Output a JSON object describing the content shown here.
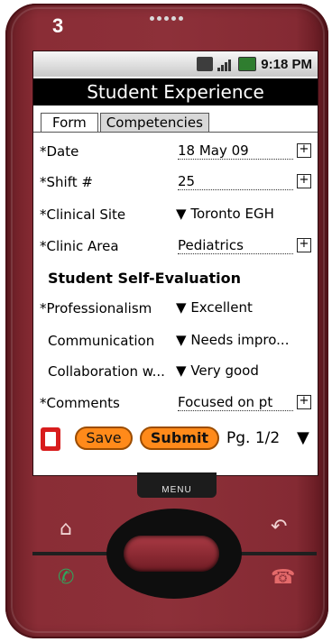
{
  "step": "3",
  "status_bar": {
    "time": "9:18 PM"
  },
  "title": "Student Experience",
  "tabs": [
    {
      "label": "Form",
      "active": true
    },
    {
      "label": "Competencies",
      "active": false
    }
  ],
  "fields": [
    {
      "label": "*Date",
      "value": "18 May 09",
      "kind": "text"
    },
    {
      "label": "*Shift #",
      "value": "25",
      "kind": "text"
    },
    {
      "label": "*Clinical Site",
      "value": "Toronto EGH",
      "kind": "dropdown"
    },
    {
      "label": "*Clinic Area",
      "value": "Pediatrics",
      "kind": "text"
    }
  ],
  "section_title": "Student Self-Evaluation",
  "evaluation": [
    {
      "label": "*Professionalism",
      "value": "Excellent",
      "kind": "dropdown"
    },
    {
      "label": "Communication",
      "value": "Needs impro...",
      "kind": "dropdown"
    },
    {
      "label": "Collaboration w...",
      "value": "Very good",
      "kind": "dropdown"
    },
    {
      "label": "*Comments",
      "value": "Focused on pt",
      "kind": "text"
    }
  ],
  "toolbar": {
    "save_label": "Save",
    "submit_label": "Submit",
    "page_indicator": "Pg. 1/2",
    "next_arrow": "▼"
  },
  "plus_symbol": "+",
  "dropdown_symbol": "▼",
  "hardware": {
    "menu_label": "MENU"
  },
  "colors": {
    "phone_body": "#8d3039",
    "action_button": "#ff8a1a",
    "trash": "#d81d1d",
    "title_bar": "#000000"
  }
}
